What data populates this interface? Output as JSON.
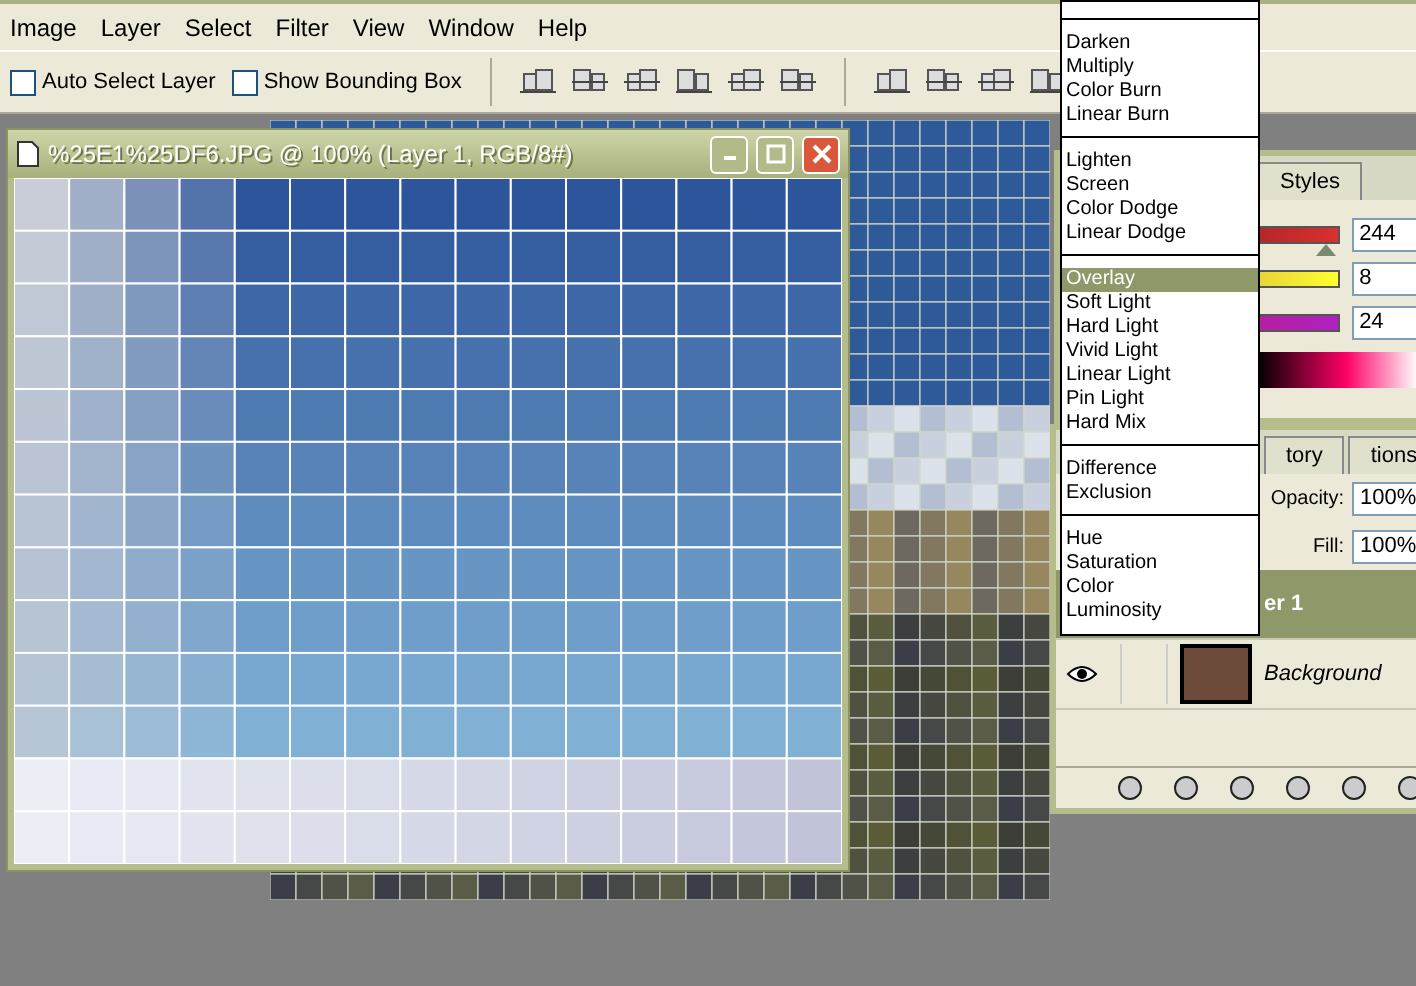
{
  "menu_bar": {
    "items": [
      "Image",
      "Layer",
      "Select",
      "Filter",
      "View",
      "Window",
      "Help"
    ]
  },
  "options_bar": {
    "checkboxes": [
      {
        "label": "Auto Select Layer",
        "checked": false
      },
      {
        "label": "Show Bounding Box",
        "checked": false
      }
    ]
  },
  "document_window": {
    "title": "%25E1%25DF6.JPG @ 100% (Layer 1, RGB/8#)"
  },
  "color_panel": {
    "tabs": [
      {
        "label": "Styles",
        "selected": false
      }
    ],
    "sliders": [
      {
        "kind": "red",
        "level": 0.96,
        "reading": "244"
      },
      {
        "kind": "yellow",
        "level": 0.03,
        "reading": "8"
      },
      {
        "kind": "magenta",
        "level": 0.09,
        "reading": "24"
      }
    ]
  },
  "layers_panel": {
    "tabs": [
      {
        "label": "tory",
        "selected": false
      },
      {
        "label": "tions",
        "selected": false
      }
    ],
    "opacity": {
      "label": "Opacity:",
      "value": "100%"
    },
    "fill": {
      "label": "Fill:",
      "value": "100%"
    },
    "layers": [
      {
        "name": "er 1",
        "selected": true,
        "italic": false
      },
      {
        "name": "Background",
        "selected": false,
        "italic": true
      }
    ]
  },
  "blend_menu": {
    "groups": [
      [
        {
          "label": "Darken",
          "selected": false
        },
        {
          "label": "Multiply",
          "selected": false
        },
        {
          "label": "Color Burn",
          "selected": false
        },
        {
          "label": "Linear Burn",
          "selected": false
        }
      ],
      [
        {
          "label": "Lighten",
          "selected": false
        },
        {
          "label": "Screen",
          "selected": false
        },
        {
          "label": "Color Dodge",
          "selected": false
        },
        {
          "label": "Linear Dodge",
          "selected": false
        }
      ],
      [
        {
          "label": "Overlay",
          "selected": true
        },
        {
          "label": "Soft Light",
          "selected": false
        },
        {
          "label": "Hard Light",
          "selected": false
        },
        {
          "label": "Vivid Light",
          "selected": false
        },
        {
          "label": "Linear Light",
          "selected": false
        },
        {
          "label": "Pin Light",
          "selected": false
        },
        {
          "label": "Hard Mix",
          "selected": false
        }
      ],
      [
        {
          "label": "Difference",
          "selected": false
        },
        {
          "label": "Exclusion",
          "selected": false
        }
      ],
      [
        {
          "label": "Hue",
          "selected": false
        },
        {
          "label": "Saturation",
          "selected": false
        },
        {
          "label": "Color",
          "selected": false
        },
        {
          "label": "Luminosity",
          "selected": false
        }
      ]
    ]
  }
}
